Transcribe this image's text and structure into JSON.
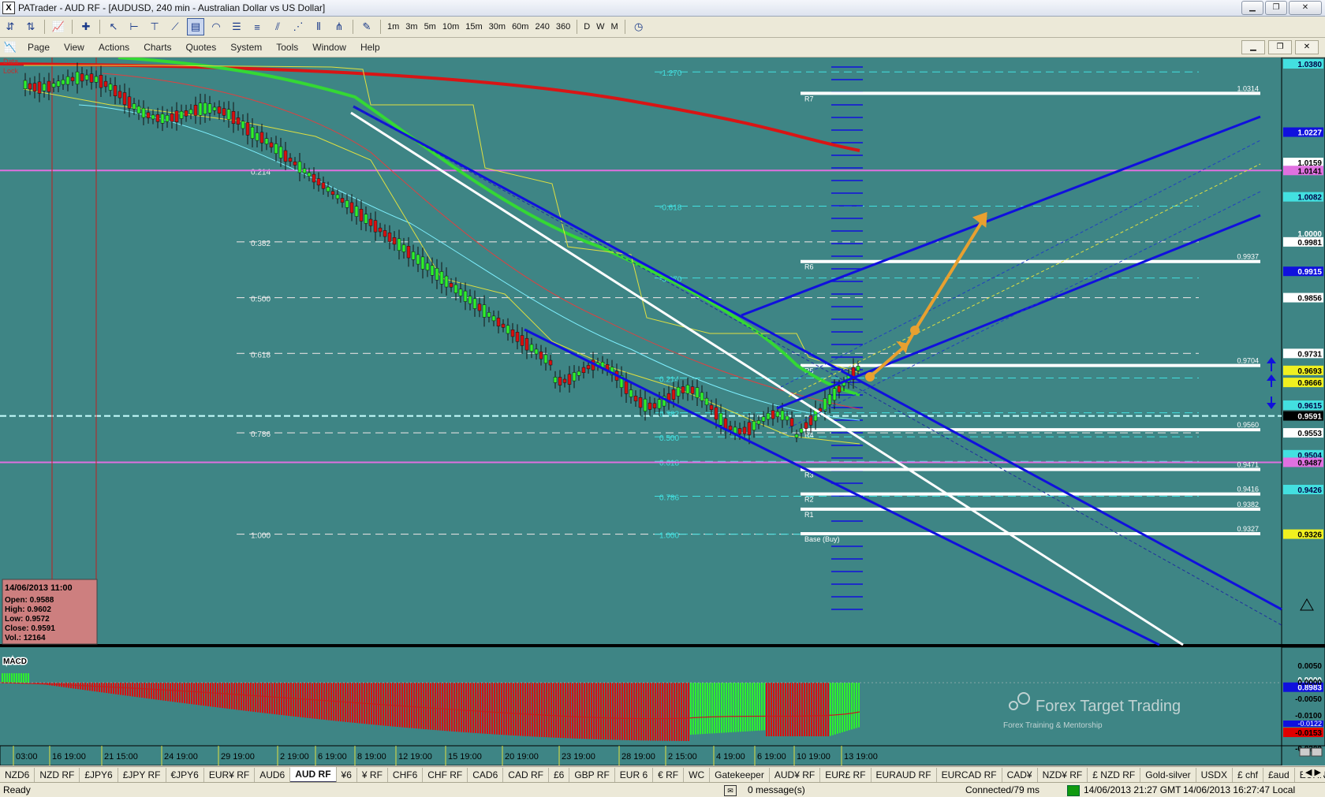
{
  "window": {
    "title": "PATrader - AUD RF - [AUDUSD, 240 min - Australian Dollar vs US Dollar]",
    "app_icon": "X"
  },
  "toolbar": {
    "timeframes": [
      "1m",
      "3m",
      "5m",
      "10m",
      "15m",
      "30m",
      "60m",
      "240",
      "360",
      "D",
      "W",
      "M"
    ]
  },
  "menu": {
    "items": [
      "Page",
      "View",
      "Actions",
      "Charts",
      "Quotes",
      "System",
      "Tools",
      "Window",
      "Help"
    ]
  },
  "chart": {
    "symbol": "AUDUSD",
    "corner_label_1": "Data",
    "corner_label_2": "Lock",
    "price_axis": [
      {
        "label": "1.0380",
        "style": "cyan",
        "y": 1.038
      },
      {
        "label": "1.0227",
        "style": "blue",
        "y": 1.0227
      },
      {
        "label": "1.0159",
        "style": "white",
        "y": 1.0159
      },
      {
        "label": "1.0141",
        "style": "magenta",
        "y": 1.0141
      },
      {
        "label": "1.0082",
        "style": "cyan",
        "y": 1.0082
      },
      {
        "label": "1.0000",
        "style": "plain",
        "y": 1.0
      },
      {
        "label": "0.9981",
        "style": "white",
        "y": 0.9981
      },
      {
        "label": "0.9915",
        "style": "blue",
        "y": 0.9915
      },
      {
        "label": "0.9856",
        "style": "white",
        "y": 0.9856
      },
      {
        "label": "0.9731",
        "style": "white",
        "y": 0.9731
      },
      {
        "label": "0.9693",
        "style": "yellow",
        "y": 0.9693
      },
      {
        "label": "0.9666",
        "style": "yellow",
        "y": 0.9666
      },
      {
        "label": "0.9615",
        "style": "cyan",
        "y": 0.9615
      },
      {
        "label": "0.9591",
        "style": "black",
        "y": 0.9591
      },
      {
        "label": "0.9553",
        "style": "white",
        "y": 0.9553
      },
      {
        "label": "0.9504",
        "style": "cyan",
        "y": 0.9504
      },
      {
        "label": "0.9487",
        "style": "magenta",
        "y": 0.9487
      },
      {
        "label": "0.9426",
        "style": "cyan",
        "y": 0.9426
      },
      {
        "label": "0.9326",
        "style": "yellow",
        "y": 0.9326
      },
      {
        "label": "0.9000",
        "style": "plain",
        "y": 0.9
      },
      {
        "label": "0.8983",
        "style": "blue",
        "y": 0.8983
      }
    ],
    "fib_left": [
      {
        "label": "0.214",
        "y": 1.0141
      },
      {
        "label": "0.382",
        "y": 0.9981
      },
      {
        "label": "0.500",
        "y": 0.9856
      },
      {
        "label": "0.618",
        "y": 0.9731
      },
      {
        "label": "0.786",
        "y": 0.9553
      },
      {
        "label": "1.000",
        "y": 0.9326
      }
    ],
    "fib_right": [
      {
        "label": "-1.270",
        "y": 1.0362
      },
      {
        "label": "-0.618",
        "y": 1.0061
      },
      {
        "label": "-0.270",
        "y": 0.99
      },
      {
        "label": "0.214",
        "y": 0.9676
      },
      {
        "label": "0.382",
        "y": 0.9598
      },
      {
        "label": "0.500",
        "y": 0.9544
      },
      {
        "label": "0.618",
        "y": 0.9489
      },
      {
        "label": "0.786",
        "y": 0.9411
      },
      {
        "label": "1.000",
        "y": 0.9326
      }
    ],
    "pivots": [
      {
        "name": "R7",
        "value": "1.0314",
        "y": 1.0314
      },
      {
        "name": "R6",
        "value": "0.9937",
        "y": 0.9937
      },
      {
        "name": "R5",
        "value": "0.9704",
        "y": 0.9704
      },
      {
        "name": "R4",
        "value": "0.9560",
        "y": 0.956
      },
      {
        "name": "R3",
        "value": "0.9471",
        "y": 0.9471
      },
      {
        "name": "R2",
        "value": "0.9416",
        "y": 0.9416
      },
      {
        "name": "R1",
        "value": "0.9382",
        "y": 0.9382
      },
      {
        "name": "Base (Buy)",
        "value": "0.9327",
        "y": 0.9327
      }
    ],
    "ohlc": {
      "date": "14/06/2013 11:00",
      "open": "Open: 0.9588",
      "high": "High: 0.9602",
      "low": "Low: 0.9572",
      "close": "Close: 0.9591",
      "vol": "Vol.: 12164"
    },
    "time_axis": [
      "03:00",
      "16 19:00",
      "21 15:00",
      "24 19:00",
      "29 19:00",
      "2 19:00",
      "6 19:00",
      "8 19:00",
      "12 19:00",
      "15 19:00",
      "20 19:00",
      "23 19:00",
      "28 19:00",
      "2 15:00",
      "4 19:00",
      "6 19:00",
      "10 19:00",
      "13 19:00"
    ],
    "macd": {
      "label": "MACD",
      "axis": [
        "0.0050",
        "0.0000",
        "-0.0050",
        "-0.0100",
        "-0.0150",
        "-0.0200"
      ],
      "tag_blue": "-0.0122",
      "tag_red": "-0.0153"
    },
    "watermark": {
      "title": "Forex Target Trading",
      "subtitle": "Forex Training & Mentorship"
    },
    "colors": {
      "background": "#3e8585",
      "channel": "#1010dd",
      "ma_long": "#d81515",
      "ma_mid": "#34d834",
      "bull": "#2ef02e",
      "bear": "#d81010",
      "arrow": "#e8a030",
      "fib": "#dddddd",
      "fib_cyan": "#43e0e0"
    }
  },
  "tabs": {
    "items": [
      "NZD6",
      "NZD RF",
      "£JPY6",
      "£JPY RF",
      "€JPY6",
      "EUR¥ RF",
      "AUD6",
      "AUD RF",
      "¥6",
      "¥ RF",
      "CHF6",
      "CHF RF",
      "CAD6",
      "CAD RF",
      "£6",
      "GBP RF",
      "EUR 6",
      "€ RF",
      "WC",
      "Gatekeeper",
      "AUD¥ RF",
      "EUR£ RF",
      "EURAUD RF",
      "EURCAD RF",
      "CAD¥",
      "NZD¥ RF",
      "£ NZD RF",
      "Gold-silver",
      "USDX",
      "£ chf",
      "£aud",
      "EURNZD RF"
    ],
    "active": "AUD RF"
  },
  "status": {
    "ready": "Ready",
    "messages": "0 message(s)",
    "connection": "Connected/79 ms",
    "gmt_time": "14/06/2013 21:27 GMT",
    "local_time": "14/06/2013 16:27:47 Local"
  }
}
